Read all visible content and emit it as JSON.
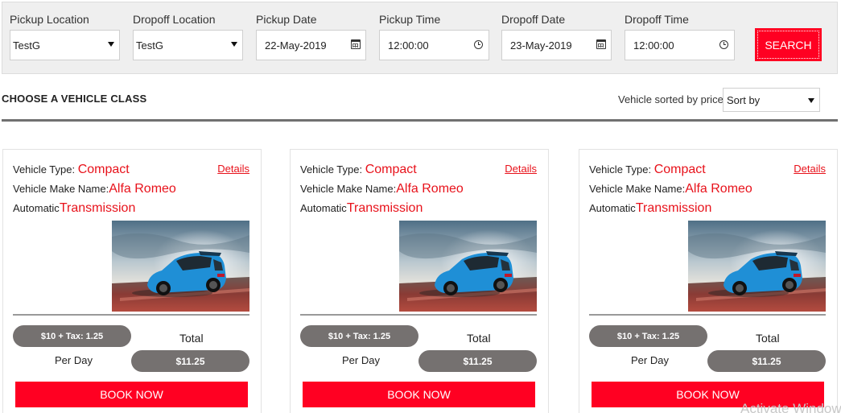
{
  "search": {
    "pickup_location": {
      "label": "Pickup Location",
      "value": "TestG"
    },
    "dropoff_location": {
      "label": "Dropoff Location",
      "value": "TestG"
    },
    "pickup_date": {
      "label": "Pickup Date",
      "value": "22-May-2019"
    },
    "pickup_time": {
      "label": "Pickup Time",
      "value": "12:00:00"
    },
    "dropoff_date": {
      "label": "Dropoff Date",
      "value": "23-May-2019"
    },
    "dropoff_time": {
      "label": "Dropoff Time",
      "value": "12:00:00"
    },
    "button_label": "SEARCH"
  },
  "section": {
    "title": "CHOOSE A VEHICLE CLASS",
    "sort_label": "Vehicle sorted by price",
    "sort_value": "Sort by"
  },
  "cards": [
    {
      "type_label": "Vehicle Type: ",
      "type_value": "Compact",
      "make_label": "Vehicle Make Name:",
      "make_value": "Alfa Romeo",
      "trans_label": "Automatic",
      "trans_value": "Transmission",
      "details": "Details",
      "price_breakdown": "$10 + Tax: 1.25",
      "total_label": "Total",
      "per_day_label": "Per Day",
      "total_value": "$11.25",
      "book_label": "BOOK NOW"
    },
    {
      "type_label": "Vehicle Type: ",
      "type_value": "Compact",
      "make_label": "Vehicle Make Name:",
      "make_value": "Alfa Romeo",
      "trans_label": "Automatic",
      "trans_value": "Transmission",
      "details": "Details",
      "price_breakdown": "$10 + Tax: 1.25",
      "total_label": "Total",
      "per_day_label": "Per Day",
      "total_value": "$11.25",
      "book_label": "BOOK NOW"
    },
    {
      "type_label": "Vehicle Type: ",
      "type_value": "Compact",
      "make_label": "Vehicle Make Name:",
      "make_value": "Alfa Romeo",
      "trans_label": "Automatic",
      "trans_value": "Transmission",
      "details": "Details",
      "price_breakdown": "$10 + Tax: 1.25",
      "total_label": "Total",
      "per_day_label": "Per Day",
      "total_value": "$11.25",
      "book_label": "BOOK NOW"
    }
  ],
  "watermark": "Activate Windows",
  "colors": {
    "accent_red": "#ff0022",
    "text_red": "#e8121b",
    "pill_gray": "#757170",
    "bar_background": "#efefef"
  },
  "icons": {
    "select": "chevron-down-icon",
    "date": "calendar-icon",
    "time": "clock-icon"
  }
}
